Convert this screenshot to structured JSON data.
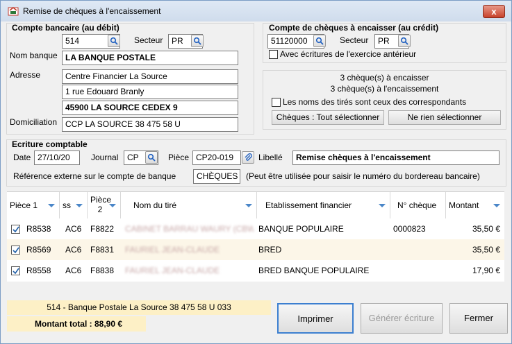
{
  "window": {
    "title": "Remise de chèques à l'encaissement",
    "close": "x"
  },
  "debit": {
    "header": "Compte bancaire (au débit)",
    "account": "514",
    "secteur_label": "Secteur",
    "secteur": "PR",
    "nom_banque_label": "Nom banque",
    "nom_banque": "LA BANQUE POSTALE",
    "adresse_label": "Adresse",
    "adresse1": "Centre Financier La Source",
    "adresse2": "1 rue Edouard Branly",
    "adresse3": "45900 LA SOURCE CEDEX 9",
    "domiciliation_label": "Domiciliation",
    "domiciliation": "CCP LA SOURCE 38 475 58 U"
  },
  "credit": {
    "header": "Compte de chèques à encaisser (au crédit)",
    "account": "51120000",
    "secteur_label": "Secteur",
    "secteur": "PR",
    "ecritures_label": "Avec écritures de l'exercice antérieur",
    "summary1": "3 chèque(s) à encaisser",
    "summary2": "3 chèque(s) à l'encaissement",
    "noms_label": "Les noms des tirés sont ceux des correspondants",
    "select_all": "Chèques : Tout sélectionner",
    "select_none": "Ne rien sélectionner"
  },
  "ecriture": {
    "header": "Ecriture comptable",
    "date_label": "Date",
    "date": "27/10/20",
    "journal_label": "Journal",
    "journal": "CP",
    "piece_label": "Pièce",
    "piece": "CP20-019",
    "libelle_label": "Libellé",
    "libelle": "Remise chèques à l'encaissement",
    "ref_label": "Référence externe sur le compte de banque",
    "ref": "CHÈQUES",
    "ref_hint": "(Peut être utilisée pour saisir le numéro du bordereau bancaire)"
  },
  "table": {
    "columns": [
      "Pièce 1",
      "ss",
      "Pièce 2",
      "Nom du tiré",
      "Etablissement financier",
      "N° chèque",
      "Montant"
    ],
    "rows": [
      {
        "checked": true,
        "piece1": "R8538",
        "ss": "AC6",
        "piece2": "F8822",
        "nom": "CABINET BARRAU WAURY (CBW)",
        "etab": "BANQUE POPULAIRE",
        "cheque": "0000823",
        "montant": "35,50 €"
      },
      {
        "checked": true,
        "piece1": "R8569",
        "ss": "AC6",
        "piece2": "F8831",
        "nom": "FAURIEL JEAN-CLAUDE",
        "etab": "BRED",
        "cheque": "",
        "montant": "35,50 €"
      },
      {
        "checked": true,
        "piece1": "R8558",
        "ss": "AC6",
        "piece2": "F8838",
        "nom": "FAURIEL JEAN-CLAUDE",
        "etab": "BRED BANQUE POPULAIRE",
        "cheque": "",
        "montant": "17,90 €"
      }
    ]
  },
  "footer": {
    "bank_info": "514 - Banque Postale La Source 38 475 58 U 033",
    "total": "Montant total : 88,90 €",
    "print": "Imprimer",
    "generate": "Générer écriture",
    "close": "Fermer"
  }
}
